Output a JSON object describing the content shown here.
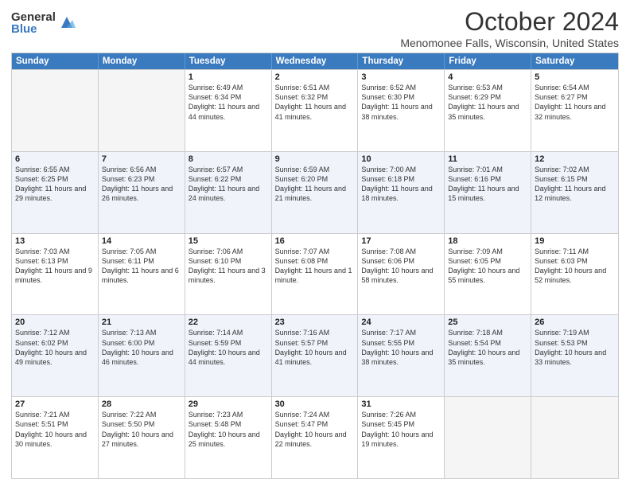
{
  "logo": {
    "general": "General",
    "blue": "Blue"
  },
  "title": "October 2024",
  "location": "Menomonee Falls, Wisconsin, United States",
  "days_header": [
    "Sunday",
    "Monday",
    "Tuesday",
    "Wednesday",
    "Thursday",
    "Friday",
    "Saturday"
  ],
  "weeks": [
    [
      {
        "day": "",
        "sunrise": "",
        "sunset": "",
        "daylight": ""
      },
      {
        "day": "",
        "sunrise": "",
        "sunset": "",
        "daylight": ""
      },
      {
        "day": "1",
        "sunrise": "Sunrise: 6:49 AM",
        "sunset": "Sunset: 6:34 PM",
        "daylight": "Daylight: 11 hours and 44 minutes."
      },
      {
        "day": "2",
        "sunrise": "Sunrise: 6:51 AM",
        "sunset": "Sunset: 6:32 PM",
        "daylight": "Daylight: 11 hours and 41 minutes."
      },
      {
        "day": "3",
        "sunrise": "Sunrise: 6:52 AM",
        "sunset": "Sunset: 6:30 PM",
        "daylight": "Daylight: 11 hours and 38 minutes."
      },
      {
        "day": "4",
        "sunrise": "Sunrise: 6:53 AM",
        "sunset": "Sunset: 6:29 PM",
        "daylight": "Daylight: 11 hours and 35 minutes."
      },
      {
        "day": "5",
        "sunrise": "Sunrise: 6:54 AM",
        "sunset": "Sunset: 6:27 PM",
        "daylight": "Daylight: 11 hours and 32 minutes."
      }
    ],
    [
      {
        "day": "6",
        "sunrise": "Sunrise: 6:55 AM",
        "sunset": "Sunset: 6:25 PM",
        "daylight": "Daylight: 11 hours and 29 minutes."
      },
      {
        "day": "7",
        "sunrise": "Sunrise: 6:56 AM",
        "sunset": "Sunset: 6:23 PM",
        "daylight": "Daylight: 11 hours and 26 minutes."
      },
      {
        "day": "8",
        "sunrise": "Sunrise: 6:57 AM",
        "sunset": "Sunset: 6:22 PM",
        "daylight": "Daylight: 11 hours and 24 minutes."
      },
      {
        "day": "9",
        "sunrise": "Sunrise: 6:59 AM",
        "sunset": "Sunset: 6:20 PM",
        "daylight": "Daylight: 11 hours and 21 minutes."
      },
      {
        "day": "10",
        "sunrise": "Sunrise: 7:00 AM",
        "sunset": "Sunset: 6:18 PM",
        "daylight": "Daylight: 11 hours and 18 minutes."
      },
      {
        "day": "11",
        "sunrise": "Sunrise: 7:01 AM",
        "sunset": "Sunset: 6:16 PM",
        "daylight": "Daylight: 11 hours and 15 minutes."
      },
      {
        "day": "12",
        "sunrise": "Sunrise: 7:02 AM",
        "sunset": "Sunset: 6:15 PM",
        "daylight": "Daylight: 11 hours and 12 minutes."
      }
    ],
    [
      {
        "day": "13",
        "sunrise": "Sunrise: 7:03 AM",
        "sunset": "Sunset: 6:13 PM",
        "daylight": "Daylight: 11 hours and 9 minutes."
      },
      {
        "day": "14",
        "sunrise": "Sunrise: 7:05 AM",
        "sunset": "Sunset: 6:11 PM",
        "daylight": "Daylight: 11 hours and 6 minutes."
      },
      {
        "day": "15",
        "sunrise": "Sunrise: 7:06 AM",
        "sunset": "Sunset: 6:10 PM",
        "daylight": "Daylight: 11 hours and 3 minutes."
      },
      {
        "day": "16",
        "sunrise": "Sunrise: 7:07 AM",
        "sunset": "Sunset: 6:08 PM",
        "daylight": "Daylight: 11 hours and 1 minute."
      },
      {
        "day": "17",
        "sunrise": "Sunrise: 7:08 AM",
        "sunset": "Sunset: 6:06 PM",
        "daylight": "Daylight: 10 hours and 58 minutes."
      },
      {
        "day": "18",
        "sunrise": "Sunrise: 7:09 AM",
        "sunset": "Sunset: 6:05 PM",
        "daylight": "Daylight: 10 hours and 55 minutes."
      },
      {
        "day": "19",
        "sunrise": "Sunrise: 7:11 AM",
        "sunset": "Sunset: 6:03 PM",
        "daylight": "Daylight: 10 hours and 52 minutes."
      }
    ],
    [
      {
        "day": "20",
        "sunrise": "Sunrise: 7:12 AM",
        "sunset": "Sunset: 6:02 PM",
        "daylight": "Daylight: 10 hours and 49 minutes."
      },
      {
        "day": "21",
        "sunrise": "Sunrise: 7:13 AM",
        "sunset": "Sunset: 6:00 PM",
        "daylight": "Daylight: 10 hours and 46 minutes."
      },
      {
        "day": "22",
        "sunrise": "Sunrise: 7:14 AM",
        "sunset": "Sunset: 5:59 PM",
        "daylight": "Daylight: 10 hours and 44 minutes."
      },
      {
        "day": "23",
        "sunrise": "Sunrise: 7:16 AM",
        "sunset": "Sunset: 5:57 PM",
        "daylight": "Daylight: 10 hours and 41 minutes."
      },
      {
        "day": "24",
        "sunrise": "Sunrise: 7:17 AM",
        "sunset": "Sunset: 5:55 PM",
        "daylight": "Daylight: 10 hours and 38 minutes."
      },
      {
        "day": "25",
        "sunrise": "Sunrise: 7:18 AM",
        "sunset": "Sunset: 5:54 PM",
        "daylight": "Daylight: 10 hours and 35 minutes."
      },
      {
        "day": "26",
        "sunrise": "Sunrise: 7:19 AM",
        "sunset": "Sunset: 5:53 PM",
        "daylight": "Daylight: 10 hours and 33 minutes."
      }
    ],
    [
      {
        "day": "27",
        "sunrise": "Sunrise: 7:21 AM",
        "sunset": "Sunset: 5:51 PM",
        "daylight": "Daylight: 10 hours and 30 minutes."
      },
      {
        "day": "28",
        "sunrise": "Sunrise: 7:22 AM",
        "sunset": "Sunset: 5:50 PM",
        "daylight": "Daylight: 10 hours and 27 minutes."
      },
      {
        "day": "29",
        "sunrise": "Sunrise: 7:23 AM",
        "sunset": "Sunset: 5:48 PM",
        "daylight": "Daylight: 10 hours and 25 minutes."
      },
      {
        "day": "30",
        "sunrise": "Sunrise: 7:24 AM",
        "sunset": "Sunset: 5:47 PM",
        "daylight": "Daylight: 10 hours and 22 minutes."
      },
      {
        "day": "31",
        "sunrise": "Sunrise: 7:26 AM",
        "sunset": "Sunset: 5:45 PM",
        "daylight": "Daylight: 10 hours and 19 minutes."
      },
      {
        "day": "",
        "sunrise": "",
        "sunset": "",
        "daylight": ""
      },
      {
        "day": "",
        "sunrise": "",
        "sunset": "",
        "daylight": ""
      }
    ]
  ]
}
